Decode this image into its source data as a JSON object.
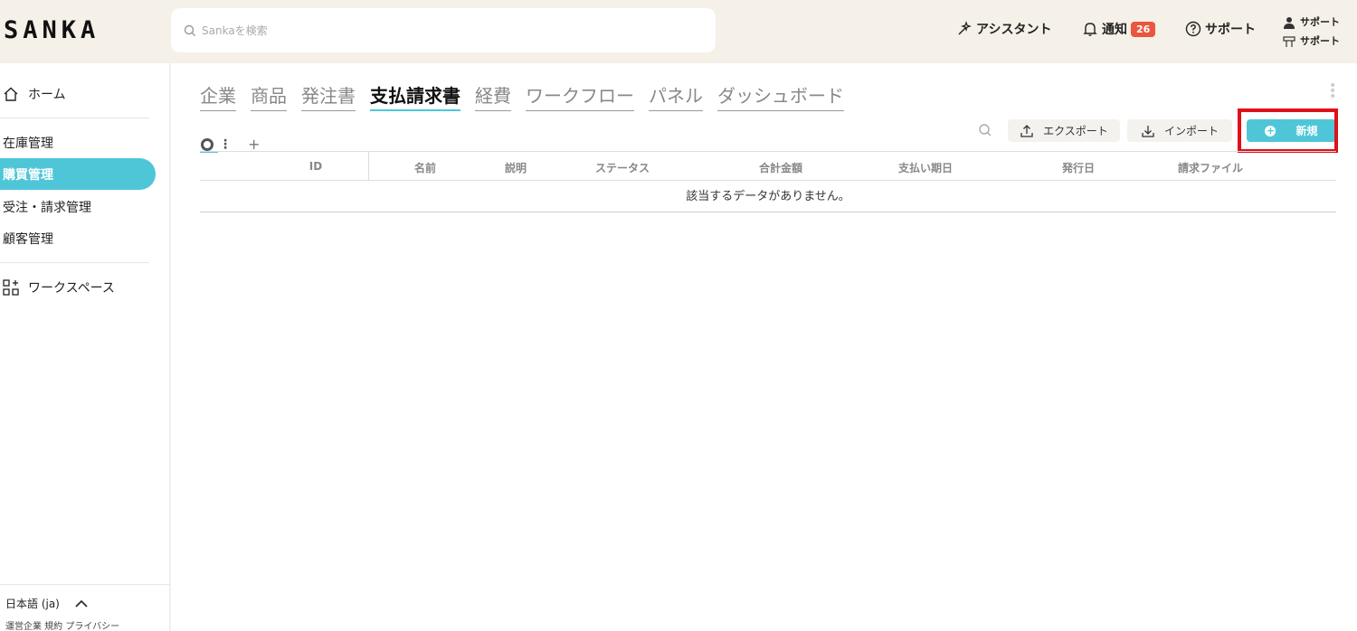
{
  "header": {
    "logo": "SANKA",
    "search_placeholder": "Sankaを検索",
    "assistant": "アシスタント",
    "notifications": "通知",
    "notification_count": "26",
    "support": "サポート",
    "user_name": "サポート",
    "user_workspace": "サポート"
  },
  "sidebar": {
    "home": "ホーム",
    "items": [
      "在庫管理",
      "購買管理",
      "受注・請求管理",
      "顧客管理"
    ],
    "workspace": "ワークスペース",
    "language": "日本語 (ja)",
    "footer": "運営企業 規約 プライバシー"
  },
  "main": {
    "tabs": [
      "企業",
      "商品",
      "発注書",
      "支払請求書",
      "経費",
      "ワークフロー",
      "パネル",
      "ダッシュボード"
    ],
    "active_tab": "支払請求書",
    "export_label": "エクスポート",
    "import_label": "インポート",
    "new_label": "新規",
    "columns": [
      "ID",
      "名前",
      "説明",
      "ステータス",
      "合計金額",
      "支払い期日",
      "発行日",
      "請求ファイル"
    ],
    "empty_message": "該当するデータがありません。"
  },
  "colors": {
    "accent": "#4ec6d8",
    "badge": "#e9573e",
    "highlight": "#e0101a",
    "header_bg": "#f5f0e8"
  }
}
